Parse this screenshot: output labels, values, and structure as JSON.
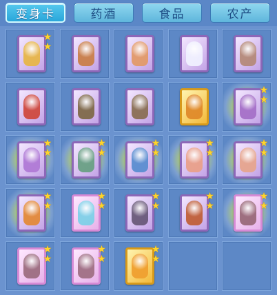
{
  "tabs": [
    {
      "label": "变身卡",
      "active": true
    },
    {
      "label": "药酒",
      "active": false
    },
    {
      "label": "食品",
      "active": false
    },
    {
      "label": "农产",
      "active": false
    }
  ],
  "icons": {
    "star": "★"
  },
  "cards": [
    {
      "name": "golden-dragon-card",
      "frame": "purple",
      "stars": 2,
      "glow": false,
      "figure_color": "#e7b64a"
    },
    {
      "name": "warrior-tiger-card",
      "frame": "purple",
      "stars": 0,
      "glow": false,
      "figure_color": "#c97f4a"
    },
    {
      "name": "monkey-spirit-card",
      "frame": "purple",
      "stars": 0,
      "glow": false,
      "figure_color": "#e29a6a"
    },
    {
      "name": "white-rabbit-card",
      "frame": "purple",
      "stars": 0,
      "glow": false,
      "figure_color": "#f0f0ff"
    },
    {
      "name": "dark-fairy-card",
      "frame": "purple",
      "stars": 0,
      "glow": false,
      "figure_color": "#b58a7a"
    },
    {
      "name": "red-dragon-card",
      "frame": "purple",
      "stars": 0,
      "glow": false,
      "figure_color": "#cf4a40"
    },
    {
      "name": "armored-general-card",
      "frame": "purple",
      "stars": 0,
      "glow": false,
      "figure_color": "#7f6a4a"
    },
    {
      "name": "armored-general-card-2",
      "frame": "purple",
      "stars": 0,
      "glow": false,
      "figure_color": "#8a6f55"
    },
    {
      "name": "golden-beast-card",
      "frame": "gold",
      "stars": 0,
      "glow": false,
      "figure_color": "#e08a2a"
    },
    {
      "name": "purple-spirit-card",
      "frame": "purple",
      "stars": 2,
      "glow": true,
      "figure_color": "#a570c8"
    },
    {
      "name": "purple-mage-card",
      "frame": "purple",
      "stars": 2,
      "glow": true,
      "figure_color": "#b07ad6"
    },
    {
      "name": "jade-warrior-card",
      "frame": "purple",
      "stars": 2,
      "glow": true,
      "figure_color": "#6aa085"
    },
    {
      "name": "blue-dragon-warrior-card",
      "frame": "purple",
      "stars": 2,
      "glow": true,
      "figure_color": "#5b8ed0"
    },
    {
      "name": "rabbit-fighter-card",
      "frame": "purple",
      "stars": 2,
      "glow": true,
      "figure_color": "#e9a08a"
    },
    {
      "name": "rabbit-fighter-card-2",
      "frame": "purple",
      "stars": 2,
      "glow": true,
      "figure_color": "#e6a58e"
    },
    {
      "name": "fox-spirit-card",
      "frame": "purple",
      "stars": 2,
      "glow": true,
      "figure_color": "#e38a3a"
    },
    {
      "name": "ice-fairy-card",
      "frame": "pink",
      "stars": 2,
      "glow": false,
      "figure_color": "#7fd0e8"
    },
    {
      "name": "dark-bird-card",
      "frame": "purple",
      "stars": 2,
      "glow": false,
      "figure_color": "#6a5a7a"
    },
    {
      "name": "lion-knight-card",
      "frame": "purple",
      "stars": 2,
      "glow": false,
      "figure_color": "#c0603a"
    },
    {
      "name": "bat-lady-card",
      "frame": "pink",
      "stars": 2,
      "glow": true,
      "figure_color": "#9a6a7a"
    },
    {
      "name": "bat-lady-card-2",
      "frame": "pink",
      "stars": 2,
      "glow": false,
      "figure_color": "#9d6e80"
    },
    {
      "name": "bat-lady-card-3",
      "frame": "pink",
      "stars": 2,
      "glow": false,
      "figure_color": "#a07085"
    },
    {
      "name": "golden-fox-card",
      "frame": "gold",
      "stars": 2,
      "glow": false,
      "figure_color": "#f0a030"
    }
  ]
}
